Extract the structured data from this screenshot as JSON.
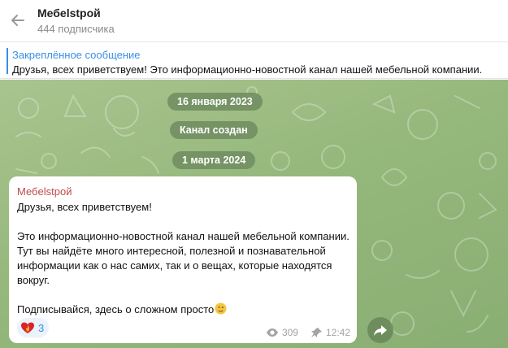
{
  "header": {
    "channel_name": "Мебelstрой",
    "subscribers": "444 подписчика",
    "back_icon": "arrow-left-icon"
  },
  "pinned": {
    "label": "Закреплённое сообщение",
    "text": "Друзья, всех приветствуем!  Это информационно-новостной канал нашей мебельной компании."
  },
  "service_messages": [
    "16 января 2023",
    "Канал создан",
    "1 марта 2024"
  ],
  "message": {
    "author": "Мебelstрой",
    "text": "Друзья, всех приветствуем!\n\nЭто информационно-новостной канал нашей мебельной компании. Тут вы найдёте много интересной, полезной и познавательной информации как о нас самих, так и о вещах, которые находятся вокруг.\n\nПодписывайся, здесь о сложном просто",
    "reaction": {
      "emoji": "heart-on-fire-icon",
      "count": "3"
    },
    "views": "309",
    "time": "12:42"
  },
  "colors": {
    "accent": "#3a8ee6",
    "author": "#c04b4b",
    "chat_bg": "#9dbd83"
  }
}
